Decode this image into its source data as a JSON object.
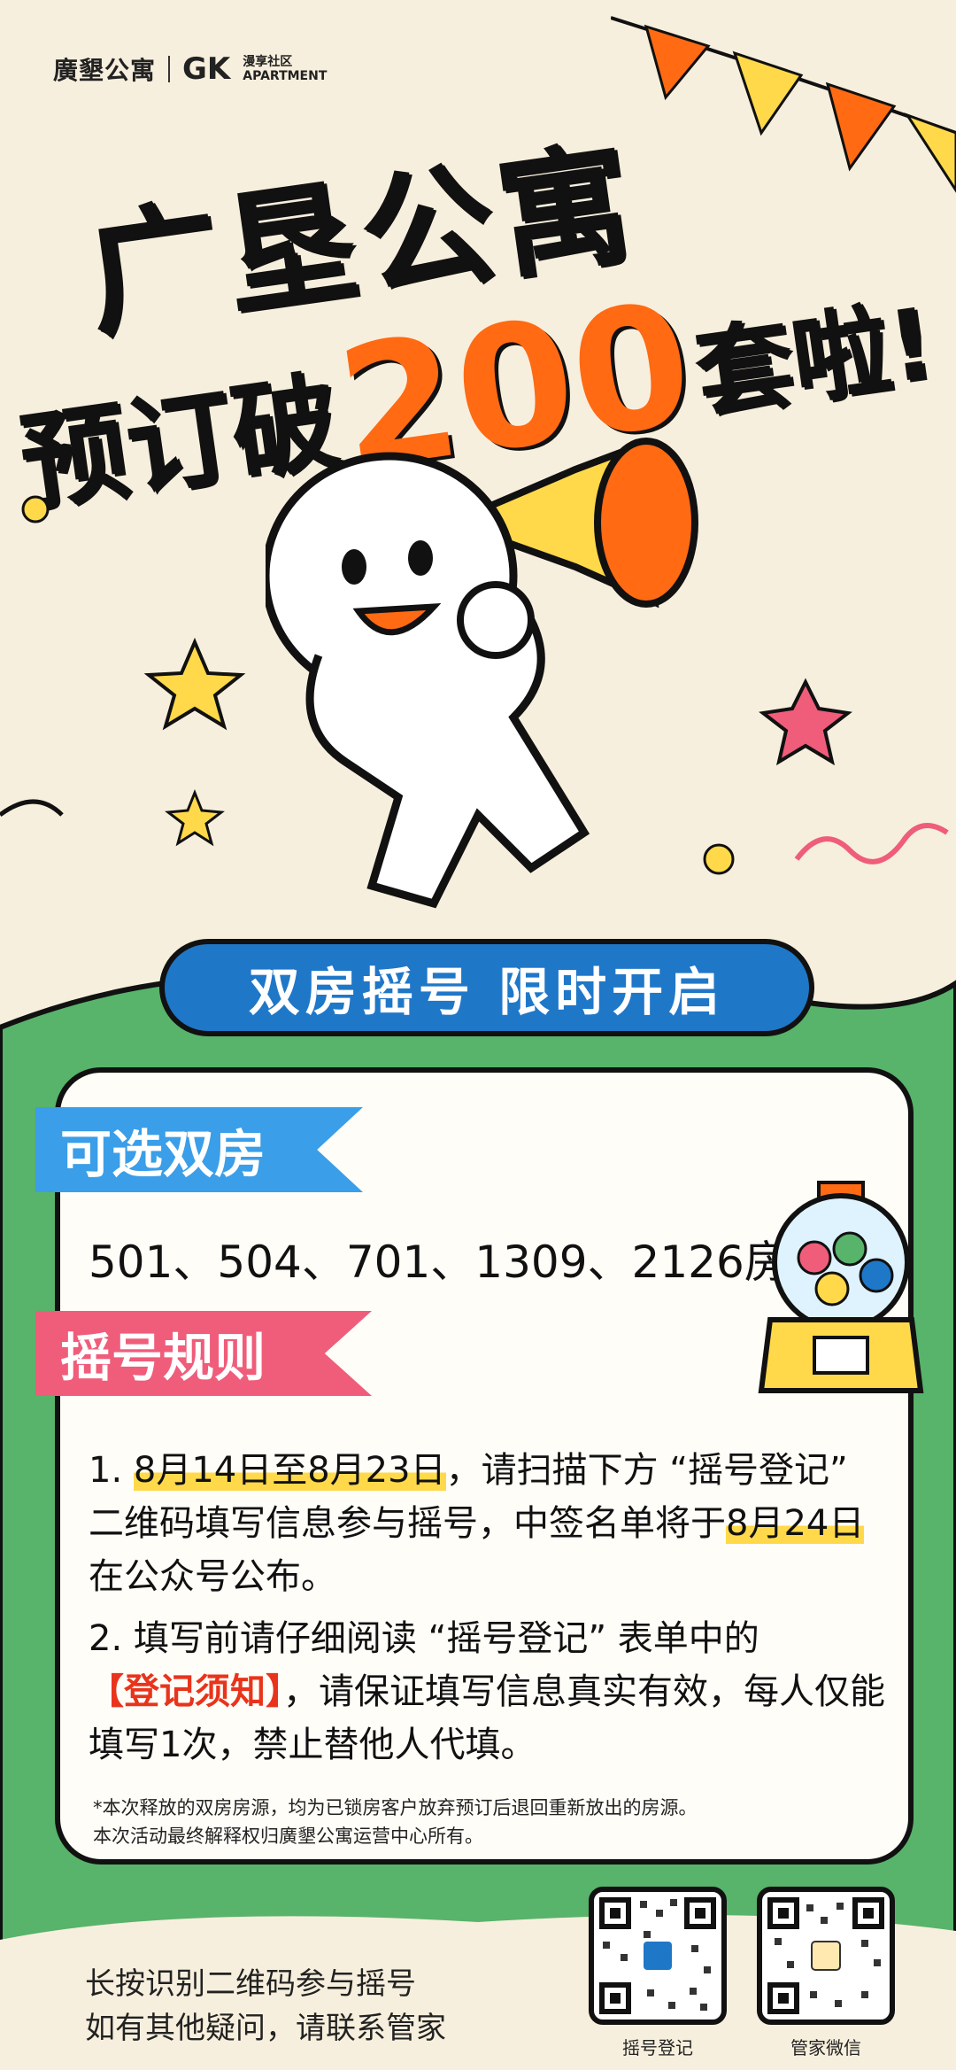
{
  "brand": {
    "name_cn": "廣墾公寓",
    "gk": "GK",
    "sub_cn": "漫享社区",
    "sub_en": "APARTMENT"
  },
  "headline": {
    "line1": "广垦公寓",
    "pre": "预订破",
    "number": "200",
    "suffix": "套啦!"
  },
  "banner": "双房摇号 限时开启",
  "section_rooms": {
    "tag": "可选双房",
    "rooms": "501、504、701、1309、2126房"
  },
  "section_rules": {
    "tag": "摇号规则",
    "rule1_prefix": "1. ",
    "rule1_date": "8月14日至8月23日",
    "rule1_mid": "，请扫描下方 “摇号登记” 二维码填写信息参与摇号，中签名单将于",
    "rule1_date2": "8月24日",
    "rule1_end": "在公众号公布。",
    "rule2_prefix": "2. 填写前请仔细阅读 “摇号登记” 表单中的",
    "rule2_red": "【登记须知】",
    "rule2_end": "，请保证填写信息真实有效，每人仅能填写1次，禁止替他人代填。"
  },
  "note": {
    "line1": "*本次释放的双房房源，均为已锁房客户放弃预订后退回重新放出的房源。",
    "line2": "本次活动最终解释权归廣墾公寓运营中心所有。"
  },
  "footer": {
    "line1": "长按识别二维码参与摇号",
    "line2": "如有其他疑问，请联系管家"
  },
  "qr_codes": [
    {
      "label": "摇号登记"
    },
    {
      "label": "管家微信"
    }
  ],
  "colors": {
    "orange": "#ff6a13",
    "blue": "#1f77c8",
    "green": "#58b36b",
    "pink": "#ef5d7a",
    "yellow": "#ffd94a"
  }
}
